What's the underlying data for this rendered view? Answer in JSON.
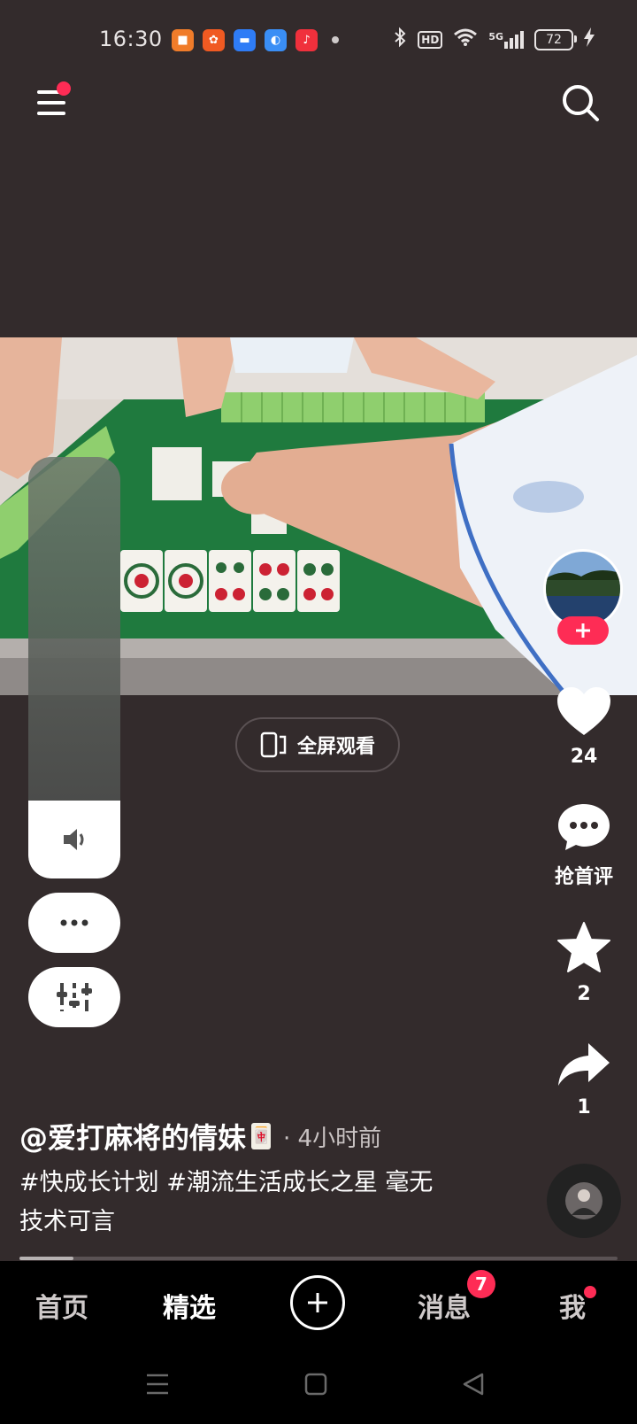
{
  "status_bar": {
    "time": "16:30",
    "app_icons": [
      {
        "name": "book-app-icon",
        "color": "#f07c2a",
        "glyph": "■"
      },
      {
        "name": "grid-app-icon",
        "color": "#f05a22",
        "glyph": "✿"
      },
      {
        "name": "folder-app-icon",
        "color": "#2f7cf6",
        "glyph": "▬"
      },
      {
        "name": "browser-app-icon",
        "color": "#3a8ef5",
        "glyph": "◐"
      },
      {
        "name": "music-app-icon",
        "color": "#f0303c",
        "glyph": "♪"
      }
    ],
    "hd_label": "HD",
    "network_label": "5G",
    "battery_level": "72"
  },
  "fullscreen_label": "全屏观看",
  "actions": {
    "like_count": "24",
    "comment_label": "抢首评",
    "favorite_count": "2",
    "share_count": "1"
  },
  "post": {
    "author": "@爱打麻将的倩妹",
    "author_emoji": "🀄",
    "time": "· 4小时前",
    "caption": "#快成长计划 #潮流生活成长之星 毫无技术可言",
    "progress": 0.09
  },
  "bottom_nav": {
    "home": "首页",
    "featured": "精选",
    "messages": "消息",
    "messages_badge": "7",
    "me": "我"
  },
  "colors": {
    "background": "#332b2c",
    "accent": "#fe2c55",
    "nav_background": "#000000"
  }
}
